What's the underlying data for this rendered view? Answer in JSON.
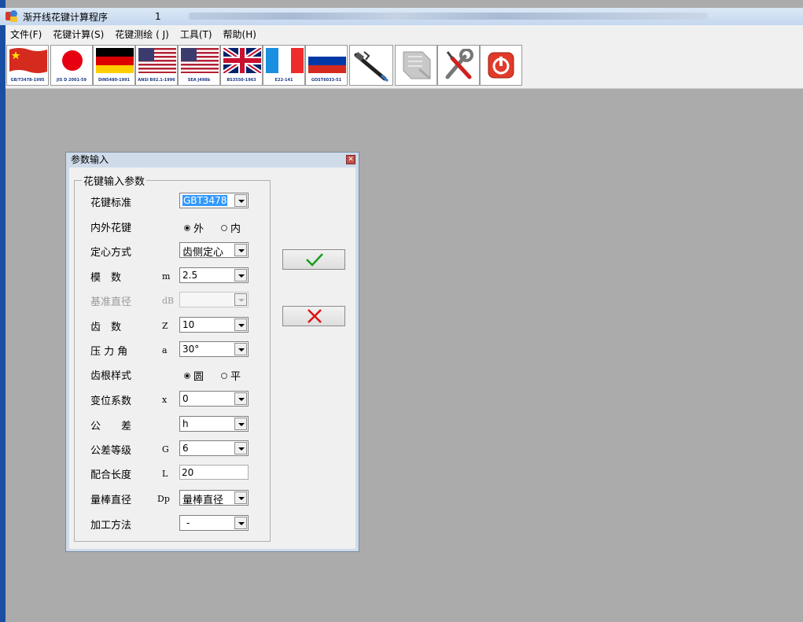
{
  "window": {
    "title": "渐开线花键计算程序",
    "number": "1"
  },
  "menu": [
    "文件(F)",
    "花键计算(S)",
    "花键测绘 ( J)",
    "工具(T)",
    "帮助(H)"
  ],
  "toolbar": {
    "buttons": [
      {
        "name": "standard-gb-button",
        "caption": "GB/T3478-1995",
        "icon": "china-flag-icon"
      },
      {
        "name": "standard-jis-button",
        "caption": "JIS D 2001-59",
        "icon": "japan-flag-icon"
      },
      {
        "name": "standard-din-button",
        "caption": "DIN5480-1991",
        "icon": "germany-flag-icon"
      },
      {
        "name": "standard-ansi-button",
        "caption": "ANSI B92.1-1996",
        "icon": "usa-flag-icon"
      },
      {
        "name": "standard-sae-button",
        "caption": "SEA J498b",
        "icon": "usa-flag-icon"
      },
      {
        "name": "standard-bs-button",
        "caption": "BS3550-1963",
        "icon": "uk-flag-icon"
      },
      {
        "name": "standard-e22-button",
        "caption": "E22-141",
        "icon": "france-flag-icon"
      },
      {
        "name": "standard-gost-button",
        "caption": "GOST6033-51",
        "icon": "russia-flag-icon"
      },
      {
        "name": "caliper-button",
        "caption": "",
        "icon": "caliper-icon"
      },
      {
        "name": "print-button",
        "caption": "",
        "icon": "print-icon"
      },
      {
        "name": "tools-button",
        "caption": "",
        "icon": "wrench-screwdriver-icon"
      },
      {
        "name": "exit-button",
        "caption": "",
        "icon": "power-icon"
      }
    ]
  },
  "dialog": {
    "title": "参数输入",
    "group_title": "花键输入参数",
    "fields": {
      "standard": {
        "label": "花键标准",
        "value": "GBT3478"
      },
      "spline_type": {
        "label": "内外花键",
        "options": [
          "外",
          "内"
        ],
        "selected": "外"
      },
      "centering": {
        "label": "定心方式",
        "value": "齿侧定心"
      },
      "module": {
        "label": "模　数",
        "symbol": "m",
        "value": "2.5"
      },
      "base_diameter": {
        "label": "基准直径",
        "symbol": "dB",
        "value": ""
      },
      "teeth": {
        "label": "齿　数",
        "symbol": "Z",
        "value": "10"
      },
      "pressure_angle": {
        "label": "压 力 角",
        "symbol": "a",
        "value": "30°"
      },
      "root_style": {
        "label": "齿根样式",
        "options": [
          "圆",
          "平"
        ],
        "selected": "圆"
      },
      "shift_coef": {
        "label": "变位系数",
        "symbol": "x",
        "value": "0"
      },
      "tolerance": {
        "label": "公　　差",
        "value": "h"
      },
      "tolerance_grade": {
        "label": "公差等级",
        "symbol": "G",
        "value": "6"
      },
      "fit_length": {
        "label": "配合长度",
        "symbol": "L",
        "value": "20"
      },
      "pin_diameter": {
        "label": "量棒直径",
        "symbol": "Dp",
        "value": "量棒直径"
      },
      "machining": {
        "label": "加工方法",
        "value": "-"
      }
    }
  },
  "colors": {
    "desktop": "#ababab",
    "dialog_frame": "#cfdbe9",
    "ok_check": "#1a9c1a",
    "cancel_x": "#e01010"
  }
}
